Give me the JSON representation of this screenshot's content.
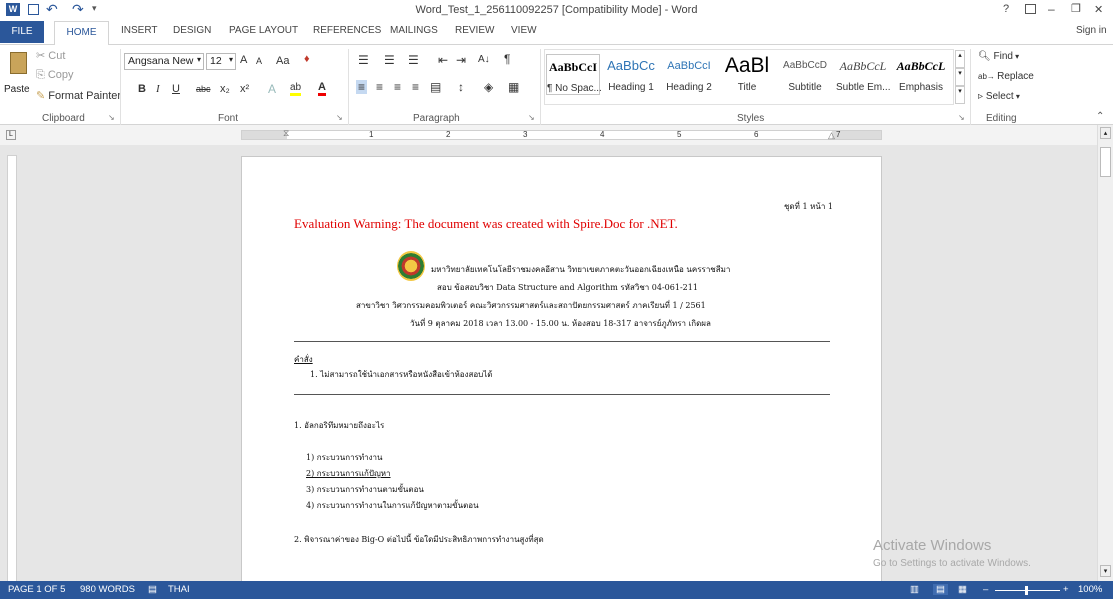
{
  "window": {
    "title": "Word_Test_1_256110092257 [Compatibility Mode] - Word",
    "help": "?",
    "minimize": "–",
    "restore": "❐",
    "close": "✕"
  },
  "quick_access": {
    "undo": "↶",
    "redo": "↷"
  },
  "tabs": [
    {
      "label": "FILE"
    },
    {
      "label": "HOME"
    },
    {
      "label": "INSERT"
    },
    {
      "label": "DESIGN"
    },
    {
      "label": "PAGE LAYOUT"
    },
    {
      "label": "REFERENCES"
    },
    {
      "label": "MAILINGS"
    },
    {
      "label": "REVIEW"
    },
    {
      "label": "VIEW"
    }
  ],
  "sign_in": "Sign in",
  "clipboard": {
    "paste": "Paste",
    "cut": "Cut",
    "copy": "Copy",
    "format_painter": "Format Painter",
    "label": "Clipboard"
  },
  "font": {
    "name": "Angsana New",
    "size": "12",
    "label": "Font",
    "bold": "B",
    "italic": "I",
    "underline": "U",
    "strike": "abc",
    "sub": "x₂",
    "sup": "x²",
    "grow": "A",
    "shrink": "A",
    "case": "Aa"
  },
  "paragraph": {
    "label": "Paragraph",
    "sort": "A↓",
    "pilcrow": "¶"
  },
  "styles": {
    "label": "Styles",
    "items": [
      {
        "sample": "AaBbCcI",
        "name": "¶ No Spac..."
      },
      {
        "sample": "AaBbCc",
        "name": "Heading 1"
      },
      {
        "sample": "AaBbCcI",
        "name": "Heading 2"
      },
      {
        "sample": "AaBl",
        "name": "Title"
      },
      {
        "sample": "AaBbCcD",
        "name": "Subtitle"
      },
      {
        "sample": "AaBbCcL",
        "name": "Subtle Em..."
      },
      {
        "sample": "AaBbCcL",
        "name": "Emphasis"
      }
    ]
  },
  "editing": {
    "find": "Find",
    "replace": "Replace",
    "select": "Select",
    "label": "Editing"
  },
  "ruler": {
    "marks": [
      "1",
      "2",
      "3",
      "4",
      "5",
      "6",
      "7"
    ]
  },
  "document": {
    "header_right": "ชุดที่ 1 หน้า 1",
    "warning": "Evaluation Warning: The document was created with Spire.Doc for .NET.",
    "uni_line": "มหาวิทยาลัยเทคโนโลยีราชมงคลอีสาน วิทยาเขตภาคตะวันออกเฉียงเหนือ นครราชสีมา",
    "exam_line": "สอบ ข้อสอบวิชา  Data Structure and Algorithm  รหัสวิชา 04-061-211",
    "dept_line": "สาขาวิชา วิศวกรรมคอมพิวเตอร์ คณะวิศวกรรมศาสตร์และสถาปัตยกรรมศาสตร์  ภาคเรียนที่ 1 / 2561",
    "date_line": "วันที่ 9 ตุลาคม 2018  เวลา 13.00 - 15.00 น.  ห้องสอบ 18-317  อาจารย์ภูภัทรา เกิดผล",
    "instr_title": "คำสั่ง",
    "instr_1": "1. ไม่สามารถใช้นำเอกสารหรือหนังสือเข้าห้องสอบได้",
    "q1": "1. อัลกอริทึมหมายถึงอะไร",
    "q1_options": [
      "1) กระบวนการทำงาน",
      "2) กระบวนการแก้ปัญหา",
      "3) กระบวนการทำงานตามขั้นตอน",
      "4) กระบวนการทำงานในการแก้ปัญหาตามขั้นตอน"
    ],
    "q2": "2. พิจารณาค่าของ Big-O ต่อไปนี้ ข้อใดมีประสิทธิภาพการทำงานสูงที่สุด"
  },
  "watermark": {
    "title": "Activate Windows",
    "sub": "Go to Settings to activate Windows."
  },
  "status": {
    "page": "PAGE 1 OF 5",
    "words": "980 WORDS",
    "lang": "THAI",
    "zoom": "100%"
  },
  "colors": {
    "accent": "#2b579a",
    "warning": "#e00000"
  }
}
